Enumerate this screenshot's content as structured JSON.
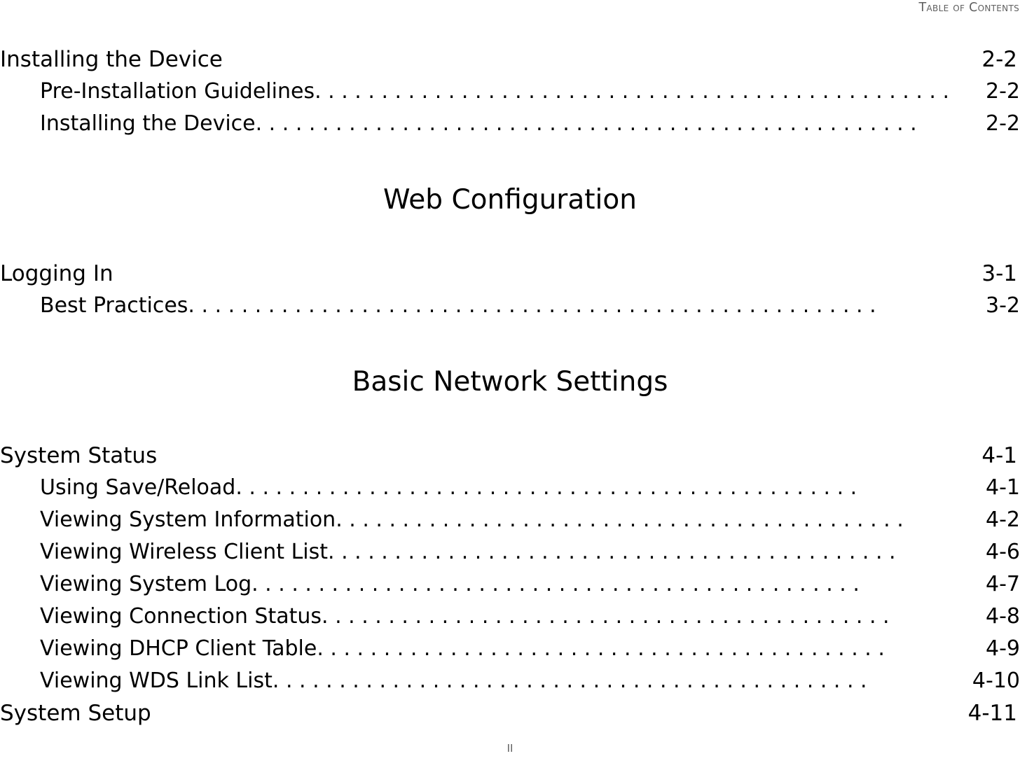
{
  "header": {
    "running_head": "Table of Contents"
  },
  "footer": {
    "folio": "II"
  },
  "toc": {
    "blocks": [
      {
        "kind": "entries",
        "rows": [
          {
            "level": 1,
            "label": "Installing the Device",
            "leader": "",
            "page": "2-2"
          },
          {
            "level": 2,
            "label": "Pre-Installation Guidelines",
            "leader": ". . . . . . . . . . . . . . . . . . . . . . . . . . . . . . . . . . . . . . . . . . . . . . . .",
            "page": "2-2"
          },
          {
            "level": 2,
            "label": "Installing the Device",
            "leader": ". . . . . . . . . . . . . . . . . . . . . . . . . . . . . . . . . . . . . . . . . . . . . . . . . .",
            "page": "2-2"
          }
        ]
      },
      {
        "kind": "part-title",
        "title": "Web Configuration"
      },
      {
        "kind": "entries",
        "rows": [
          {
            "level": 1,
            "label": "Logging In",
            "leader": "",
            "page": "3-1"
          },
          {
            "level": 2,
            "label": "Best Practices",
            "leader": ". . . . . . . . . . . . . . . . . . . . . . . . . . . . . . . . . . . . . . . . . . . . . . . . . . . .",
            "page": "3-2"
          }
        ]
      },
      {
        "kind": "part-title",
        "title": "Basic Network Settings"
      },
      {
        "kind": "entries",
        "rows": [
          {
            "level": 1,
            "label": "System Status",
            "leader": "",
            "page": "4-1"
          },
          {
            "level": 2,
            "label": "Using Save/Reload",
            "leader": ". . . . . . . . . . . . . . . . . . . . . . . . . . . . . . . . . . . . . . . . . . . . . . .",
            "page": "4-1"
          },
          {
            "level": 2,
            "label": "Viewing System Information",
            "leader": ". . . . . . . . . . . . . . . . . . . . . . . . . . . . . . . . . . . . . . . . . . .",
            "page": "4-2"
          },
          {
            "level": 2,
            "label": "Viewing Wireless Client List",
            "leader": ". . . . . . . . . . . . . . . . . . . . . . . . . . . . . . . . . . . . . . . . . . .",
            "page": "4-6"
          },
          {
            "level": 2,
            "label": "Viewing System Log",
            "leader": ". . . . . . . . . . . . . . . . . . . . . . . . . . . . . . . . . . . . . . . . . . . . . .",
            "page": "4-7"
          },
          {
            "level": 2,
            "label": "Viewing Connection Status",
            "leader": ". . . . . . . . . . . . . . . . . . . . . . . . . . . . . . . . . . . . . . . . . . .",
            "page": "4-8"
          },
          {
            "level": 2,
            "label": "Viewing DHCP Client Table",
            "leader": ". . . . . . . . . . . . . . . . . . . . . . . . . . . . . . . . . . . . . . . . . . .",
            "page": "4-9"
          },
          {
            "level": 2,
            "label": "Viewing WDS Link List",
            "leader": ". . . . . . . . . . . . . . . . . . . . . . . . . . . . . . . . . . . . . . . . . . . . .",
            "page": "4-10"
          },
          {
            "level": 1,
            "label": "System Setup",
            "leader": "",
            "page": "4-11"
          }
        ]
      }
    ]
  }
}
